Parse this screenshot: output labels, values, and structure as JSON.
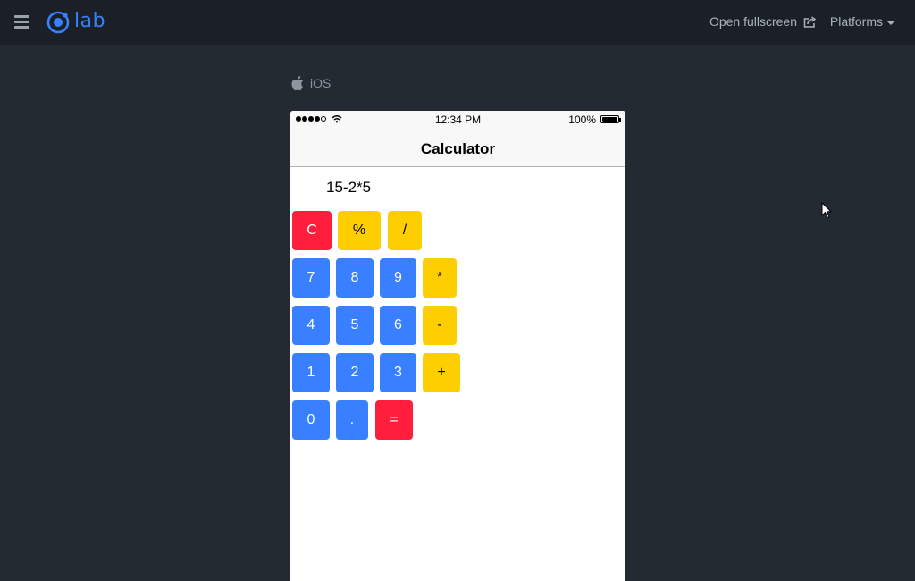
{
  "app": {
    "logo_text": "lab"
  },
  "header": {
    "open_fullscreen_label": "Open fullscreen",
    "platforms_label": "Platforms"
  },
  "platform": {
    "label": "iOS"
  },
  "device": {
    "status_bar": {
      "time": "12:34 PM",
      "battery": "100%"
    },
    "title": "Calculator",
    "display_value": "15-2*5",
    "keys": [
      {
        "label": "C",
        "color": "red"
      },
      {
        "label": "%",
        "color": "yellow"
      },
      {
        "label": "/",
        "color": "yellow"
      },
      {
        "label": "7",
        "color": "blue"
      },
      {
        "label": "8",
        "color": "blue"
      },
      {
        "label": "9",
        "color": "blue"
      },
      {
        "label": "*",
        "color": "yellow"
      },
      {
        "label": "4",
        "color": "blue"
      },
      {
        "label": "5",
        "color": "blue"
      },
      {
        "label": "6",
        "color": "blue"
      },
      {
        "label": "-",
        "color": "yellow"
      },
      {
        "label": "1",
        "color": "blue"
      },
      {
        "label": "2",
        "color": "blue"
      },
      {
        "label": "3",
        "color": "blue"
      },
      {
        "label": "+",
        "color": "yellow"
      },
      {
        "label": "0",
        "color": "blue"
      },
      {
        "label": ".",
        "color": "blue"
      },
      {
        "label": "=",
        "color": "red"
      }
    ]
  },
  "colors": {
    "brand": "#3880ff",
    "key_blue": "#3880ff",
    "key_yellow": "#ffce00",
    "key_red": "#ff1f3d",
    "background": "#242a31"
  }
}
